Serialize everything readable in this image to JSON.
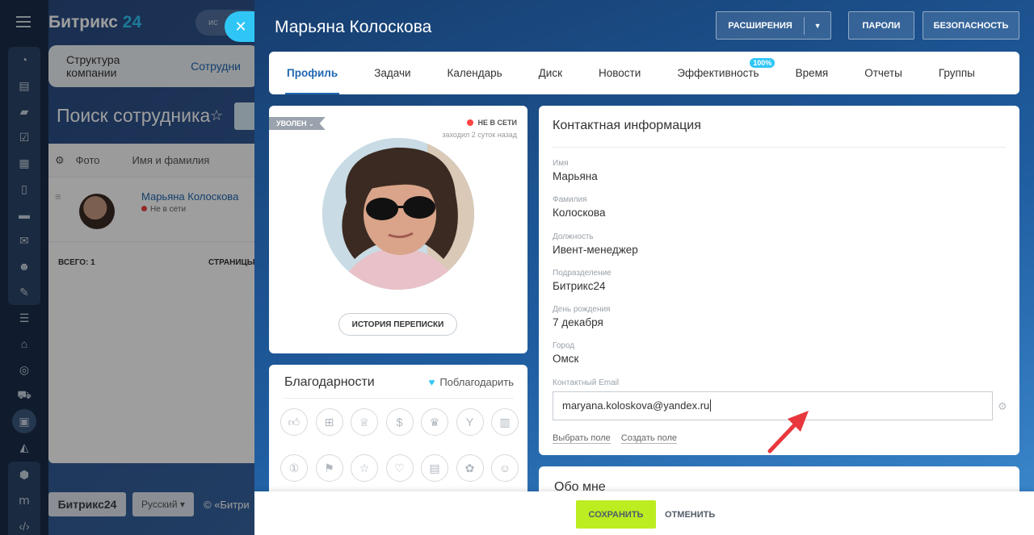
{
  "app": {
    "logo": "Битрикс",
    "logo_num": "24",
    "search_placeholder": "ис",
    "bg_tabs": [
      "Структура компании",
      "Сотрудни"
    ],
    "page_title": "Поиск сотрудника",
    "grid_headers": [
      "Фото",
      "Имя и фамилия"
    ],
    "row_name": "Марьяна Колоскова",
    "row_status": "Не в сети",
    "total": "ВСЕГО: 1",
    "pages": "СТРАНИЦЫ:",
    "footer_logo": "Битрикс24",
    "footer_lang": "Русский",
    "footer_copy": "© «Битри"
  },
  "panel": {
    "title": "Марьяна Колоскова",
    "btn_extensions": "РАСШИРЕНИЯ",
    "btn_passwords": "ПАРОЛИ",
    "btn_security": "БЕЗОПАСНОСТЬ",
    "tabs": [
      {
        "label": "Профиль"
      },
      {
        "label": "Задачи"
      },
      {
        "label": "Календарь"
      },
      {
        "label": "Диск"
      },
      {
        "label": "Новости"
      },
      {
        "label": "Эффективность",
        "badge": "100%"
      },
      {
        "label": "Время"
      },
      {
        "label": "Отчеты"
      },
      {
        "label": "Группы"
      }
    ],
    "fired_label": "УВОЛЕН",
    "online_status": "НЕ В СЕТИ",
    "last_seen": "заходил 2 суток назад",
    "history_button": "ИСТОРИЯ ПЕРЕПИСКИ",
    "thanks_title": "Благодарности",
    "thanks_link": "Поблагодарить",
    "info_title": "Контактная информация",
    "fields": [
      {
        "label": "Имя",
        "value": "Марьяна"
      },
      {
        "label": "Фамилия",
        "value": "Колоскова"
      },
      {
        "label": "Должность",
        "value": "Ивент-менеджер"
      },
      {
        "label": "Подразделение",
        "value": "Битрикс24"
      },
      {
        "label": "День рождения",
        "value": "7 декабря"
      },
      {
        "label": "Город",
        "value": "Омск"
      },
      {
        "label": "Контактный Email",
        "value": ""
      }
    ],
    "email_value": "maryana.koloskova@yandex.ru",
    "select_field": "Выбрать поле",
    "create_field": "Создать поле",
    "about_title": "Обо мне",
    "save": "СОХРАНИТЬ",
    "cancel": "ОТМЕНИТЬ"
  },
  "colors": {
    "accent": "#2fc6f6",
    "save_green": "#bbed21",
    "link_blue": "#2067b0",
    "arrow_red": "#e8383d"
  }
}
